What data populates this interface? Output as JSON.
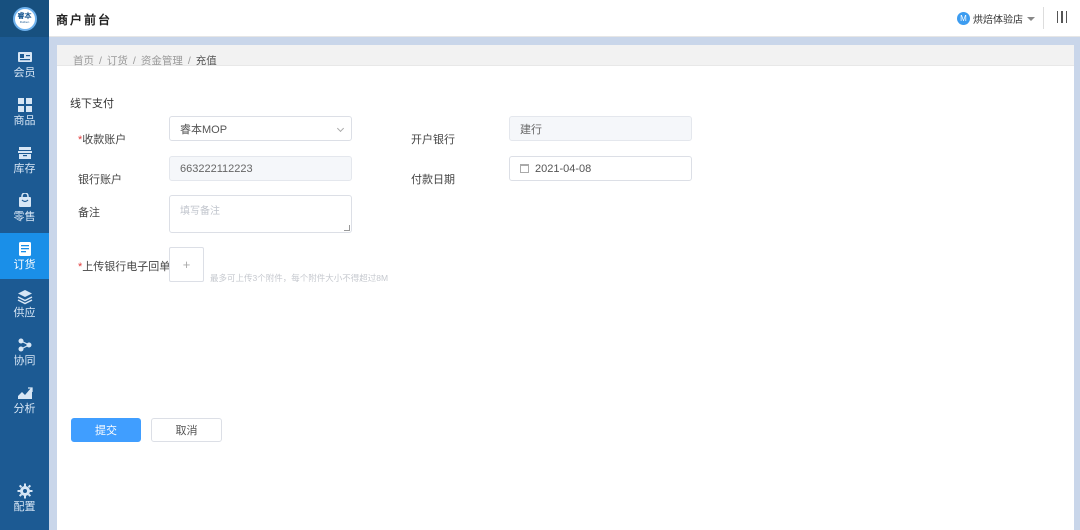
{
  "app": {
    "logo_line1": "睿本",
    "logo_line2": "Ruiben",
    "title": "商户前台"
  },
  "header": {
    "store_avatar": "M",
    "store_name": "烘焙体验店",
    "menu_icon": "vertical-bars-icon"
  },
  "sidebar": {
    "items": [
      {
        "label": "会员",
        "icon": "member-card-icon"
      },
      {
        "label": "商品",
        "icon": "grid-icon"
      },
      {
        "label": "库存",
        "icon": "inventory-icon"
      },
      {
        "label": "零售",
        "icon": "retail-bag-icon"
      },
      {
        "label": "订货",
        "icon": "order-doc-icon",
        "active": true
      },
      {
        "label": "供应",
        "icon": "layers-icon"
      },
      {
        "label": "协同",
        "icon": "collab-icon"
      },
      {
        "label": "分析",
        "icon": "analytics-icon"
      },
      {
        "label": "配置",
        "icon": "gear-icon"
      }
    ]
  },
  "breadcrumb": {
    "items": [
      "首页",
      "订货",
      "资金管理"
    ],
    "separator": "/",
    "current": "充值"
  },
  "form": {
    "section_title": "线下支付",
    "receive_account": {
      "required_mark": "*",
      "label": "收款账户",
      "value": "睿本MOP"
    },
    "open_bank": {
      "label": "开户银行",
      "value": "建行"
    },
    "bank_account": {
      "label": "银行账户",
      "value": "663222112223"
    },
    "payment_date": {
      "label": "付款日期",
      "value": "2021-04-08"
    },
    "remark": {
      "label": "备注",
      "placeholder": "填写备注"
    },
    "upload": {
      "required_mark": "*",
      "label": "上传银行电子回单",
      "plus": "+",
      "hint": "最多可上传3个附件，每个附件大小不得超过8M"
    }
  },
  "actions": {
    "submit": "提交",
    "cancel": "取消"
  },
  "colors": {
    "sidebar_bg": "#1c5a93",
    "sidebar_active": "#1a8fe8",
    "primary": "#409eff",
    "required": "#e23c3c"
  }
}
